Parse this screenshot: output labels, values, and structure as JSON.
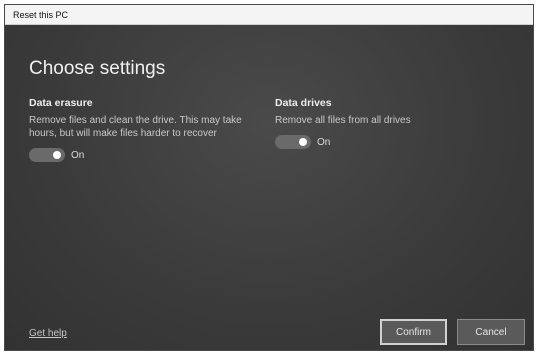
{
  "window": {
    "title": "Reset this PC"
  },
  "main": {
    "heading": "Choose settings"
  },
  "settings": [
    {
      "title": "Data erasure",
      "description": "Remove files and clean the drive. This may take hours, but will make files harder to recover",
      "toggle_state": "On"
    },
    {
      "title": "Data drives",
      "description": "Remove all files from all drives",
      "toggle_state": "On"
    }
  ],
  "footer": {
    "help_link": "Get help",
    "confirm_label": "Confirm",
    "cancel_label": "Cancel"
  }
}
